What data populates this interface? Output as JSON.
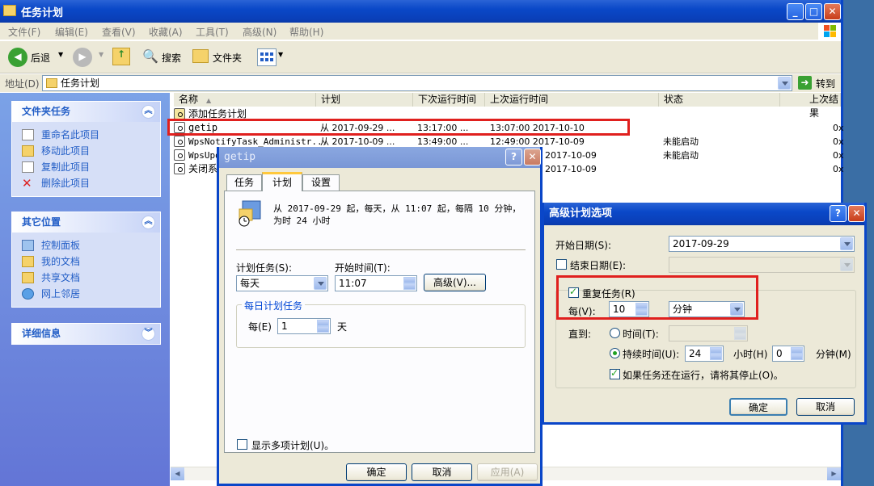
{
  "window": {
    "title": "任务计划"
  },
  "menu": [
    "文件(F)",
    "编辑(E)",
    "查看(V)",
    "收藏(A)",
    "工具(T)",
    "高级(N)",
    "帮助(H)"
  ],
  "toolbar": {
    "back": "后退",
    "search": "搜索",
    "folders": "文件夹"
  },
  "address": {
    "label": "地址(D)",
    "value": "任务计划",
    "go": "转到"
  },
  "sidebar": {
    "folder_tasks": {
      "title": "文件夹任务",
      "items": [
        "重命名此项目",
        "移动此项目",
        "复制此项目",
        "删除此项目"
      ]
    },
    "other_places": {
      "title": "其它位置",
      "items": [
        "控制面板",
        "我的文档",
        "共享文档",
        "网上邻居"
      ]
    },
    "details": {
      "title": "详细信息"
    }
  },
  "list": {
    "columns": [
      "名称",
      "计划",
      "下次运行时间",
      "上次运行时间",
      "状态",
      "上次结果"
    ],
    "rows": [
      {
        "name": "添加任务计划",
        "schedule": "",
        "next": "",
        "last": "",
        "status": "",
        "result": ""
      },
      {
        "name": "getip",
        "schedule": "从 2017-09-29 ...",
        "next": "13:17:00  ...",
        "last": "13:07:00  2017-10-10",
        "status": "",
        "result": "0x"
      },
      {
        "name": "WpsNotifyTask_Administr...",
        "schedule": "从 2017-10-09 ...",
        "next": "13:49:00  ...",
        "last": "12:49:00  2017-10-09",
        "status": "未能启动",
        "result": "0x"
      },
      {
        "name": "WpsUpd",
        "schedule": "",
        "next": "",
        "last": "2017-10-09",
        "status": "未能启动",
        "result": "0x"
      },
      {
        "name": "关闭系",
        "schedule": "",
        "next": "",
        "last": "2017-10-09",
        "status": "",
        "result": "0x"
      }
    ]
  },
  "task_dialog": {
    "title": "getip",
    "tabs": [
      "任务",
      "计划",
      "设置"
    ],
    "summary": "从 2017-09-29 起，每天，从 11:07 起，每隔 10 分钟，为时 24 小时",
    "schedule_label": "计划任务(S):",
    "schedule_value": "每天",
    "start_time_label": "开始时间(T):",
    "start_time_value": "11:07",
    "advanced_button": "高级(V)...",
    "group_title": "每日计划任务",
    "every_label": "每(E)",
    "every_value": "1",
    "every_unit": "天",
    "show_multiple": "显示多项计划(U)。",
    "ok": "确定",
    "cancel": "取消",
    "apply": "应用(A)"
  },
  "adv_dialog": {
    "title": "高级计划选项",
    "start_date_label": "开始日期(S):",
    "start_date_value": "2017-09-29",
    "end_date_label": "结束日期(E):",
    "repeat_label": "重复任务(R)",
    "every_label": "每(V):",
    "every_value": "10",
    "every_unit": "分钟",
    "until_label": "直到:",
    "time_label": "时间(T):",
    "duration_label": "持续时间(U):",
    "duration_hours": "24",
    "hours_label": "小时(H)",
    "duration_minutes": "0",
    "minutes_label": "分钟(M)",
    "stop_label": "如果任务还在运行，请将其停止(O)。",
    "ok": "确定",
    "cancel": "取消"
  },
  "colors": {
    "highlight": "#e0201e",
    "xp_blue": "#0a46c8"
  }
}
